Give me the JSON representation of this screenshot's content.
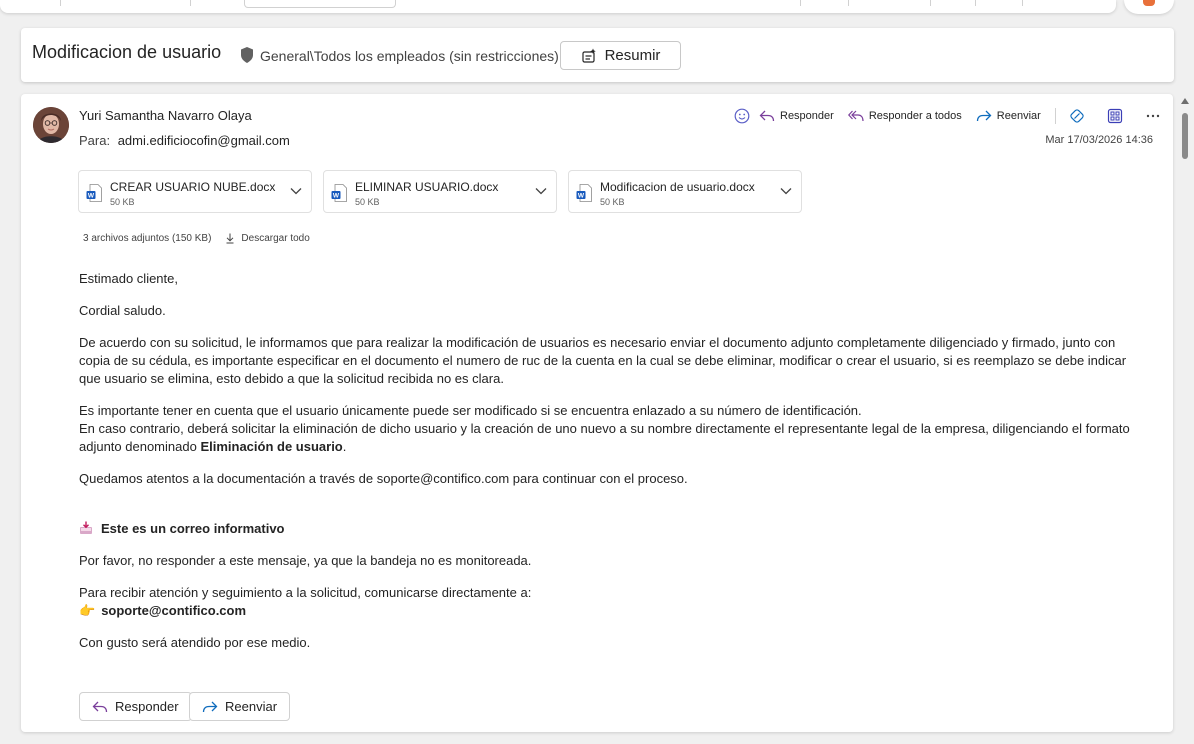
{
  "subject": {
    "title": "Modificacion de usuario",
    "sensitivity_icon": "shield-icon",
    "sensitivity_label": "General\\Todos los empleados (sin restricciones)",
    "summarize_label": "Resumir"
  },
  "message": {
    "sender_name": "Yuri Samantha Navarro Olaya",
    "to_label": "Para:",
    "to_address": "admi.edificiocofin@gmail.com",
    "date": "Mar 17/03/2026 14:36",
    "actions": {
      "reply": "Responder",
      "reply_all": "Responder a todos",
      "forward": "Reenviar"
    }
  },
  "attachments": [
    {
      "name": "CREAR USUARIO NUBE.docx",
      "size": "50 KB"
    },
    {
      "name": "ELIMINAR USUARIO.docx",
      "size": "50 KB"
    },
    {
      "name": "Modificacion de usuario.docx",
      "size": "50 KB"
    }
  ],
  "attachments_summary": "3 archivos adjuntos (150 KB)",
  "download_all": "Descargar todo",
  "body": {
    "greeting": "Estimado cliente,",
    "salute": "Cordial saludo.",
    "p1": "De acuerdo con su solicitud, le informamos que para realizar la modificación de usuarios es necesario enviar el documento adjunto completamente diligenciado y firmado, junto con copia de su cédula, es importante especificar en el documento el numero de ruc de la cuenta en la cual se debe eliminar, modificar o crear el usuario, si es reemplazo se debe indicar que usuario se elimina, esto debido a que la solicitud recibida no es clara.",
    "p2_line1": "Es importante tener en cuenta que el usuario únicamente puede ser modificado si se encuentra enlazado a su número de identificación.",
    "p2_line2": "En caso contrario, deberá solicitar la eliminación de dicho usuario y la creación de uno nuevo a su nombre directamente el representante legal de la empresa, diligenciando el formato adjunto denominado ",
    "p2_bold": "Eliminación de usuario",
    "p2_end": ".",
    "p3": "Quedamos atentos a la documentación a través de soporte@contifico.com  para continuar con el proceso.",
    "info_title": "Este es un correo informativo",
    "no_reply": "Por favor, no responder a este mensaje, ya que la bandeja no es monitoreada.",
    "contact_line": "Para recibir atención y seguimiento a la solicitud, comunicarse directamente a:",
    "contact_email": "soporte@contifico.com",
    "closing": "Con gusto será atendido por ese medio."
  },
  "bottom_actions": {
    "reply": "Responder",
    "forward": "Reenviar"
  },
  "colors": {
    "reply_arrow": "#7a3f9b",
    "forward_arrow": "#0f6cbd",
    "word_blue": "#185abd"
  }
}
